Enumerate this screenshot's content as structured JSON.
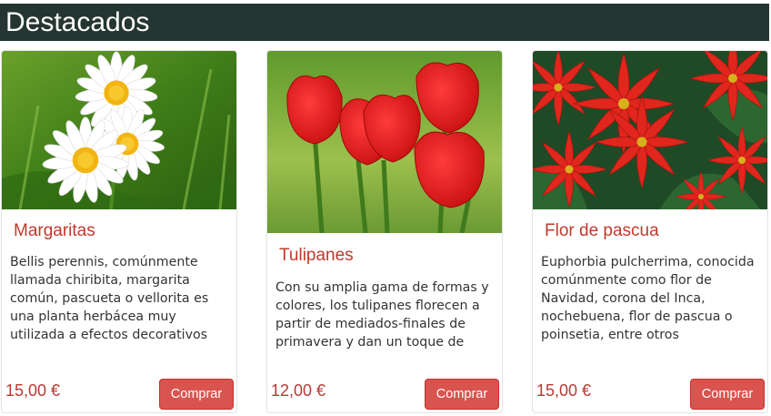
{
  "section": {
    "title": "Destacados"
  },
  "products": [
    {
      "name": "Margaritas",
      "description": "Bellis perennis, comúnmente llamada chiribita, margarita común, pascueta o vellorita es una planta herbácea muy utilizada a efectos decorativos",
      "price": "15,00 €",
      "buy_label": "Comprar",
      "image": "daisy-photo"
    },
    {
      "name": "Tulipanes",
      "description": "Con su amplia gama de formas y colores, los tulipanes florecen a partir de mediados-finales de primavera y dan un toque de animación a patios y",
      "price": "12,00 €",
      "buy_label": "Comprar",
      "image": "tulip-photo"
    },
    {
      "name": "Flor de pascua",
      "description": "Euphorbia pulcherrima, conocida comúnmente como flor de Navidad, corona del Inca, nochebuena, flor de pascua o poinsetia, entre otros",
      "price": "15,00 €",
      "buy_label": "Comprar",
      "image": "poinsettia-photo"
    }
  ],
  "colors": {
    "header_bg": "#253532",
    "title": "#c0392b",
    "price": "#b83a33",
    "button": "#d9534f"
  }
}
